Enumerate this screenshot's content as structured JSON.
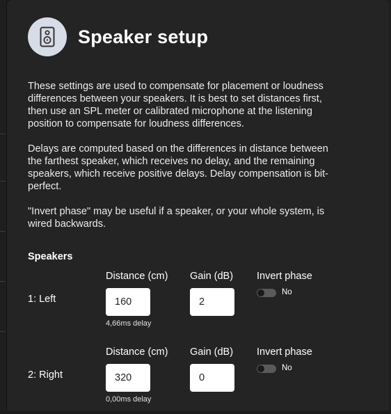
{
  "header": {
    "title": "Speaker setup",
    "icon": "speaker-icon"
  },
  "description": [
    "These settings are used to compensate for placement or loudness differences between your speakers. It is best to set distances first, then use an SPL meter or calibrated microphone at the listening position to compensate for loudness differences.",
    "Delays are computed based on the differences in distance between the farthest speaker, which receives no delay, and the remaining speakers, which receive positive delays. Delay compensation is bit-perfect.",
    "\"Invert phase\" may be useful if a speaker, or your whole system, is wired backwards."
  ],
  "speakers_section": {
    "title": "Speakers",
    "items": [
      {
        "label": "1: Left",
        "distance_header": "Distance (cm)",
        "gain_header": "Gain (dB)",
        "invert_header": "Invert phase",
        "distance": "160",
        "gain": "2",
        "delay": "4,66ms delay",
        "invert_label": "No",
        "invert_on": false
      },
      {
        "label": "2: Right",
        "distance_header": "Distance (cm)",
        "gain_header": "Gain (dB)",
        "invert_header": "Invert phase",
        "distance": "320",
        "gain": "0",
        "delay": "0,00ms delay",
        "invert_label": "No",
        "invert_on": false
      }
    ]
  },
  "colors": {
    "background": "#1b1b1b",
    "panel": "#242424",
    "icon_circle": "#d7dde6",
    "toggle_off": "#5a5a5a"
  }
}
